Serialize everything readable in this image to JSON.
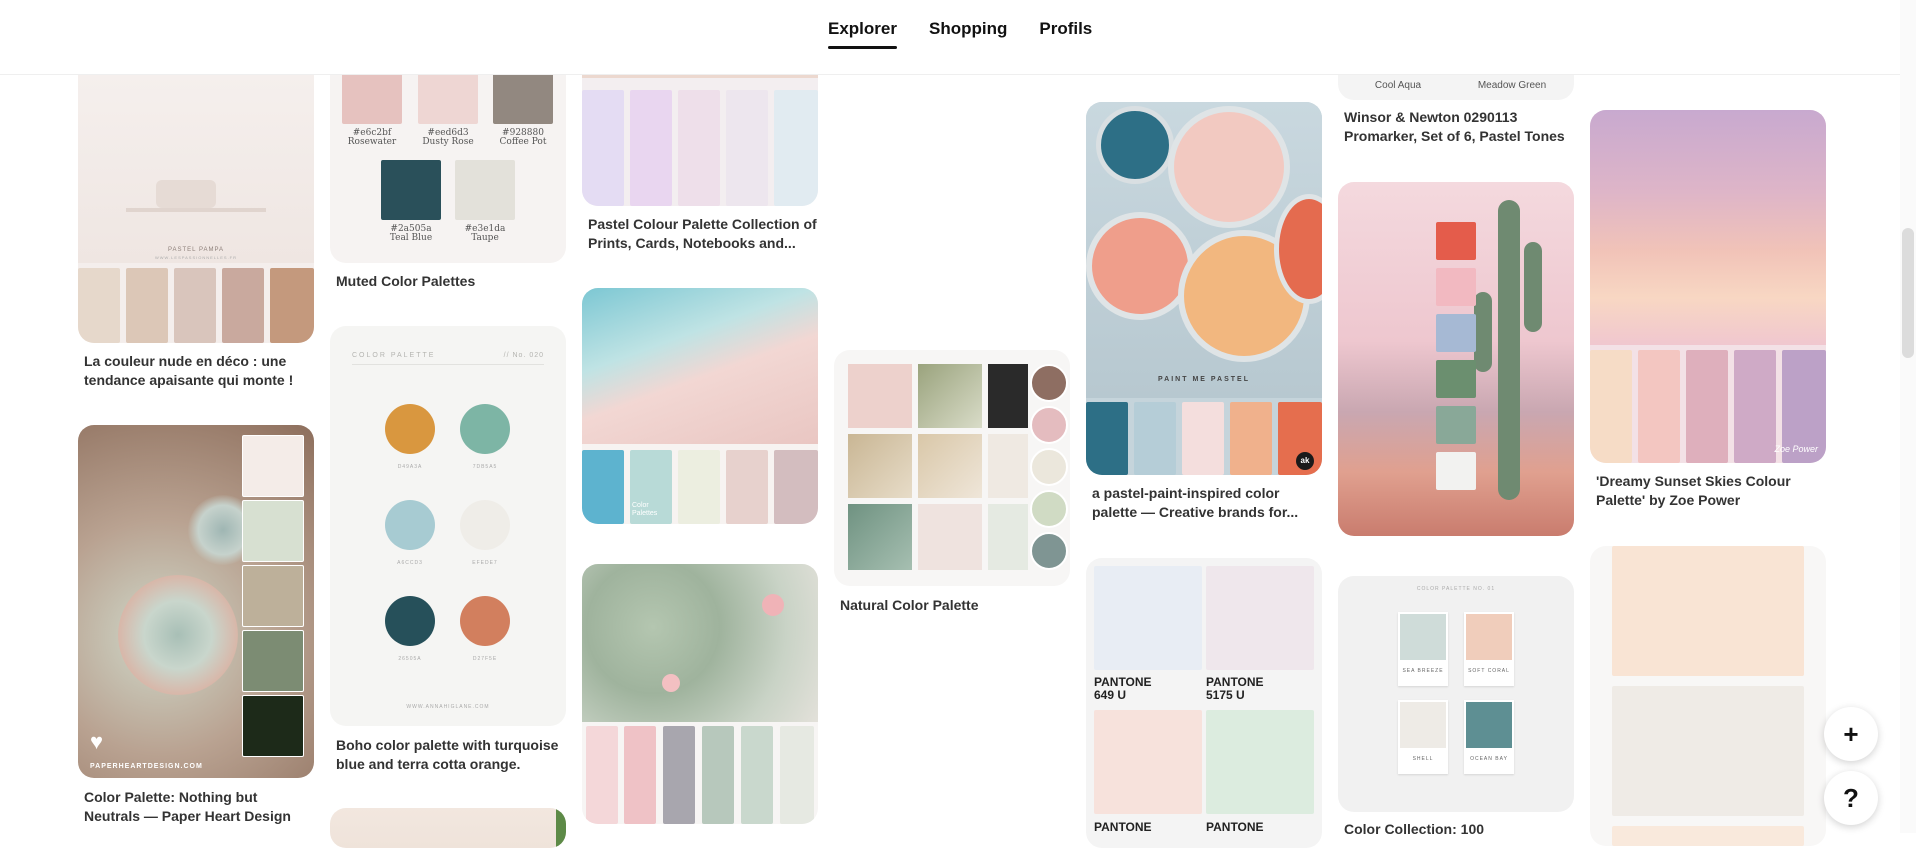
{
  "nav": {
    "tabs": [
      {
        "label": "Explorer",
        "active": true
      },
      {
        "label": "Shopping",
        "active": false
      },
      {
        "label": "Profils",
        "active": false
      }
    ]
  },
  "pins": {
    "nude_deco": {
      "caption": "La couleur nude en déco : une tendance apaisante qui monte !",
      "image_text": {
        "title": "PASTEL PAMPA",
        "url": "WWW.LESPASSIONNELLES.FR"
      },
      "swatches": [
        "#e6d8cb",
        "#dcc7b7",
        "#d9c5bc",
        "#c9a99e",
        "#c4997d"
      ]
    },
    "muted": {
      "caption": "Muted Color Palettes",
      "swatches": [
        {
          "hex": "#e6c2bf",
          "name": "Rosewater",
          "label": "#e6c2bf"
        },
        {
          "hex": "#eed6d3",
          "name": "Dusty Rose",
          "label": "#eed6d3"
        },
        {
          "hex": "#928880",
          "name": "Coffee Pot",
          "label": "#928880"
        },
        {
          "hex": "#2a505a",
          "name": "Teal Blue",
          "label": "#2a505a"
        },
        {
          "hex": "#e3e1da",
          "name": "Taupe",
          "label": "#e3e1da"
        }
      ]
    },
    "pastel_collection": {
      "caption": "Pastel Colour Palette Collection of Prints, Cards, Notebooks and...",
      "swatches": [
        "#e4dcf3",
        "#e9d6f0",
        "#eedfea",
        "#ede6ee",
        "#e1ebf1"
      ]
    },
    "winsor": {
      "labels": [
        "Cool Aqua",
        "Meadow Green"
      ],
      "caption": "Winsor & Newton 0290113 Promarker, Set of 6, Pastel Tones"
    },
    "sunset": {
      "caption": "'Dreamy Sunset Skies Colour Palette' by Zoe Power",
      "credit": "Zoe Power",
      "swatches": [
        "#f6dcc6",
        "#f3c6c1",
        "#deafbc",
        "#cfaac6",
        "#bca1c7"
      ]
    },
    "paint_cans": {
      "caption": "a pastel-paint-inspired color palette — Creative brands for...",
      "image_text": "PAINT ME PASTEL",
      "badge": "ak",
      "swatches": [
        "#2d6f86",
        "#b5cdd7",
        "#f4dedd",
        "#f0b18c",
        "#e56e4e"
      ]
    },
    "cactus": {
      "swatches": [
        "#e45c4b",
        "#f2b9c1",
        "#a6b9d4",
        "#6b8f6f",
        "#89a898",
        "#f2f2f0"
      ]
    },
    "succulent": {
      "caption": "Color Palette: Nothing but Neutrals — Paper Heart Design",
      "brand": "PAPERHEARTDESIGN.COM",
      "swatches": [
        "#f4ece8",
        "#d7e0d1",
        "#bdb09a",
        "#7c8c73",
        "#1d2a19"
      ]
    },
    "boho": {
      "caption": "Boho color palette with turquoise blue and terra cotta orange.",
      "header_left": "COLOR PALETTE",
      "header_right": "// No. 020",
      "footer": "WWW.ANNAHIGLANE.COM",
      "circles": [
        {
          "hex": "#d9973f",
          "label": "D49A3A"
        },
        {
          "hex": "#7db5a5",
          "label": "7DB5A5"
        },
        {
          "hex": "#a7cbd2",
          "label": "A6CCD3"
        },
        {
          "hex": "#efede8",
          "label": "EFEDE7"
        },
        {
          "hex": "#26505a",
          "label": "26505A"
        },
        {
          "hex": "#d27f5e",
          "label": "D27F5E"
        }
      ]
    },
    "beach": {
      "watermark": "Color Palettes",
      "swatches": [
        "#5db3cf",
        "#b8dad7",
        "#eceee0",
        "#e7d1cd",
        "#d3bdbf"
      ]
    },
    "natural": {
      "caption": "Natural Color Palette",
      "dots": [
        "#8e6e62",
        "#e4bcbf",
        "#ebe7dc",
        "#d0dbc4",
        "#7f9593"
      ]
    },
    "desert_cactus": {
      "swatches": [
        "#f4d7d9",
        "#efc2c6",
        "#a8a6ae",
        "#b7c8bc",
        "#c9d8cd",
        "#e6e9e2"
      ]
    },
    "pantone": {
      "cells": [
        {
          "hex": "#e8edf4",
          "label": "PANTONE 649 U"
        },
        {
          "hex": "#efe7ec",
          "label": "PANTONE 5175 U"
        },
        {
          "hex": "#f7e2dc",
          "label": "PANTONE"
        },
        {
          "hex": "#dcecdf",
          "label": "PANTONE"
        }
      ]
    },
    "collection": {
      "caption": "Color Collection: 100",
      "header": "COLOR PALETTE NO. 01",
      "cards": [
        {
          "hex": "#cfdcd9",
          "name": "SEA BREEZE"
        },
        {
          "hex": "#f0cdbb",
          "name": "SOFT CORAL"
        },
        {
          "hex": "#eeebe6",
          "name": "SHELL"
        },
        {
          "hex": "#5e8f93",
          "name": "OCEAN BAY"
        }
      ]
    },
    "neutral_blocks": {
      "swatches": [
        "#f9e4d4",
        "#efebe6",
        "#f9e9dc"
      ]
    }
  },
  "actions": {
    "add_icon": "+",
    "help_icon": "?"
  }
}
